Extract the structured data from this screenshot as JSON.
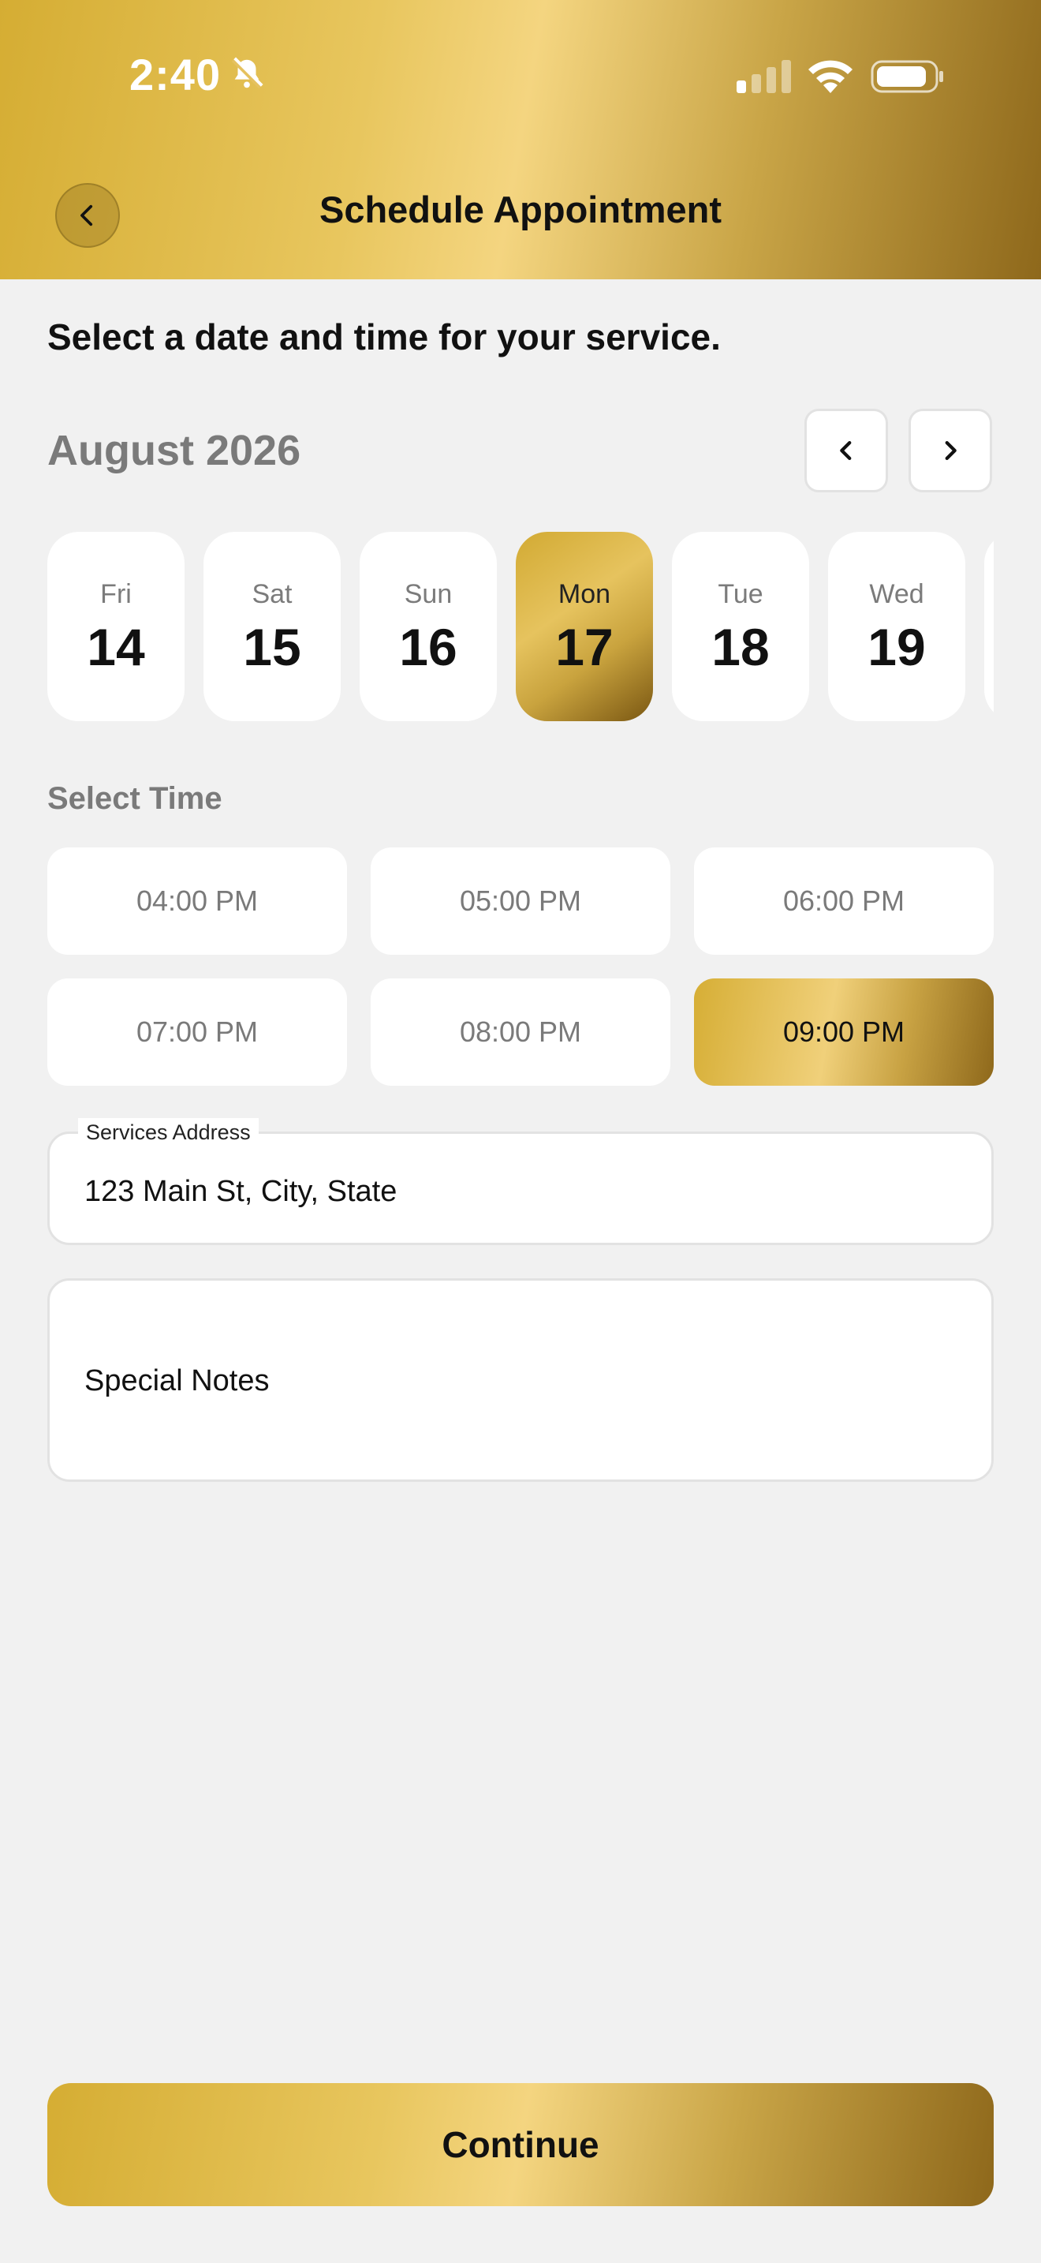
{
  "status_bar": {
    "time": "2:40"
  },
  "header": {
    "title": "Schedule Appointment"
  },
  "subtitle": "Select a date and time for your service.",
  "calendar": {
    "month_label": "August 2026",
    "days": [
      {
        "name": "Fri",
        "num": "14",
        "selected": false
      },
      {
        "name": "Sat",
        "num": "15",
        "selected": false
      },
      {
        "name": "Sun",
        "num": "16",
        "selected": false
      },
      {
        "name": "Mon",
        "num": "17",
        "selected": true
      },
      {
        "name": "Tue",
        "num": "18",
        "selected": false
      },
      {
        "name": "Wed",
        "num": "19",
        "selected": false
      },
      {
        "name": "",
        "num": "",
        "selected": false
      }
    ]
  },
  "time_section": {
    "label": "Select Time",
    "slots": [
      {
        "label": "04:00 PM",
        "selected": false
      },
      {
        "label": "05:00 PM",
        "selected": false
      },
      {
        "label": "06:00 PM",
        "selected": false
      },
      {
        "label": "07:00 PM",
        "selected": false
      },
      {
        "label": "08:00 PM",
        "selected": false
      },
      {
        "label": "09:00 PM",
        "selected": true
      }
    ]
  },
  "address_field": {
    "label": "Services Address",
    "value": "123 Main St, City, State"
  },
  "notes_field": {
    "placeholder": "Special Notes"
  },
  "continue_button": {
    "label": "Continue"
  },
  "colors": {
    "accent_gold": "#e8c65e",
    "accent_dark_gold": "#8e681b",
    "background": "#f1f1f1"
  }
}
